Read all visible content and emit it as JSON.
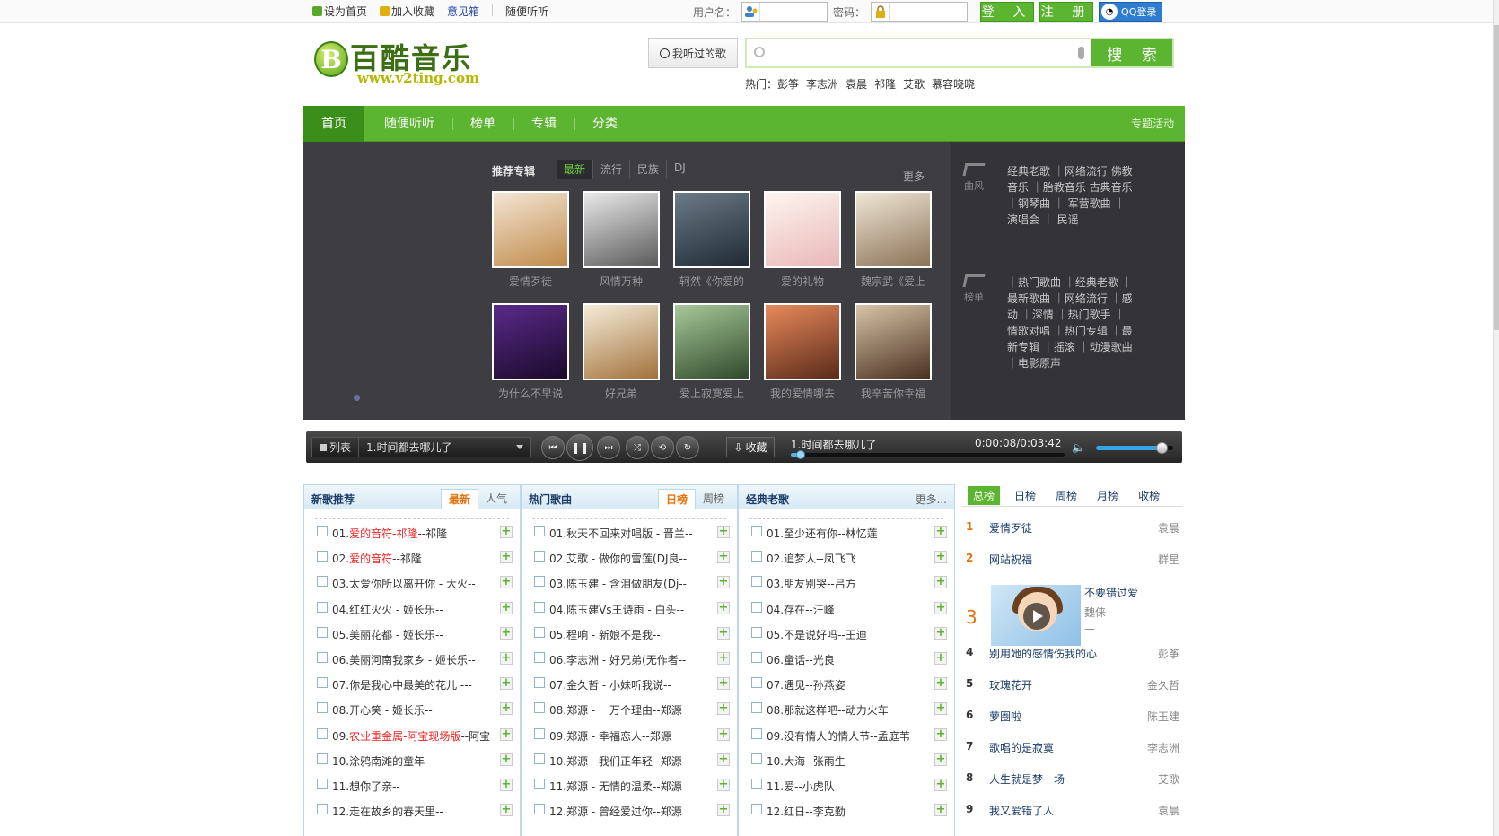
{
  "topbar": {
    "set_home": "设为首页",
    "add_fav": "加入收藏",
    "feedback": "意见箱",
    "random": "随便听听",
    "username_label": "用户名：",
    "password_label": "密码：",
    "login_btn": "登 入",
    "register_btn": "注 册",
    "qq_login": "QQ登录"
  },
  "header": {
    "logo_cn": "百酷音乐",
    "logo_url": "www.v2ting.com",
    "heard_btn": "我听过的歌",
    "search_btn": "搜 索",
    "hot_label": "热门：",
    "hot": [
      "彭筝",
      "李志洲",
      "袁晨",
      "祁隆",
      "艾歌",
      "慕容晓晓"
    ]
  },
  "nav": {
    "items": [
      "首页",
      "随便听听",
      "榜单",
      "专辑",
      "分类"
    ],
    "topic": "专题活动"
  },
  "banner": {
    "title": "推荐专辑",
    "tabs": [
      "最新",
      "流行",
      "民族",
      "DJ"
    ],
    "more": "更多",
    "albums": [
      {
        "name": "爱情歹徒",
        "color1": "#f3e5d4",
        "color2": "#c08a4a"
      },
      {
        "name": "风情万种",
        "color1": "#e9e9e9",
        "color2": "#5a5a5a"
      },
      {
        "name": "轲然《你爱的",
        "color1": "#6c7a88",
        "color2": "#1f2a33"
      },
      {
        "name": "爱的礼物",
        "color1": "#fdf5f0",
        "color2": "#e9b7b7"
      },
      {
        "name": "魏宗武《爱上",
        "color1": "#f0e6d6",
        "color2": "#8a7256"
      },
      {
        "name": "为什么不早说",
        "color1": "#5a2a8a",
        "color2": "#1a0a2a"
      },
      {
        "name": "好兄弟",
        "color1": "#f5ecd8",
        "color2": "#a2723c"
      },
      {
        "name": "爱上寂寞爱上",
        "color1": "#a8c89a",
        "color2": "#2f4a2a"
      },
      {
        "name": "我的爱情哪去",
        "color1": "#e88a5a",
        "color2": "#5a2a1a"
      },
      {
        "name": "我辛苦你幸福",
        "color1": "#d8c4a8",
        "color2": "#4a3020"
      }
    ],
    "cat1": {
      "icon_label": "曲风",
      "text": "经典老歌 ｜网络流行 佛教音乐 ｜胎教音乐 古典音乐 ｜钢琴曲 ｜ 军营歌曲 ｜演唱会 ｜ 民谣"
    },
    "cat2": {
      "icon_label": "榜单",
      "text": "｜热门歌曲 ｜经典老歌 ｜最新歌曲 ｜网络流行 ｜感动 ｜深情 ｜热门歌手 ｜情歌对唱 ｜热门专辑 ｜最新专辑 ｜摇滚 ｜动漫歌曲 ｜电影原声"
    }
  },
  "player": {
    "list_label": "列表",
    "current": "1.时间都去哪儿了",
    "collect": "收藏",
    "now_playing": "1.时间都去哪儿了",
    "time": "0:00:08/0:03:42",
    "progress": 0.036,
    "volume": 0.85
  },
  "lists": {
    "new": {
      "title": "新歌推荐",
      "tabs": [
        "最新",
        "人气"
      ],
      "rows": [
        {
          "pre": "01.",
          "red": "爱的音符-祁隆",
          "post": "--祁隆"
        },
        {
          "pre": "02.",
          "red": "爱的音符",
          "post": "--祁隆"
        },
        {
          "pre": "03.太爱你所以离开你 - 大火--",
          "red": "",
          "post": ""
        },
        {
          "pre": "04.红红火火 - 姬长乐--",
          "red": "",
          "post": ""
        },
        {
          "pre": "05.美丽花都 - 姬长乐--",
          "red": "",
          "post": ""
        },
        {
          "pre": "06.美丽河南我家乡 - 姬长乐--",
          "red": "",
          "post": ""
        },
        {
          "pre": "07.你是我心中最美的花儿 ---",
          "red": "",
          "post": ""
        },
        {
          "pre": "08.开心笑 - 姬长乐--",
          "red": "",
          "post": ""
        },
        {
          "pre": "09.",
          "red": "农业重金属-阿宝现场版",
          "post": "--阿宝"
        },
        {
          "pre": "10.涂鸦南滩的童年--",
          "red": "",
          "post": ""
        },
        {
          "pre": "11.想你了亲--",
          "red": "",
          "post": ""
        },
        {
          "pre": "12.走在故乡的春天里--",
          "red": "",
          "post": ""
        }
      ]
    },
    "hot": {
      "title": "热门歌曲",
      "tabs": [
        "日榜",
        "周榜"
      ],
      "rows": [
        "01.秋天不回来对唱版 - 晋兰--",
        "02.艾歌 - 做你的雪莲(DJ良--",
        "03.陈玉建 - 含泪做朋友(Dj--",
        "04.陈玉建Vs王诗雨 - 白头--",
        "05.程响 - 新娘不是我--",
        "06.李志洲 - 好兄弟(无作者--",
        "07.金久哲 - 小妹听我说--",
        "08.郑源 - 一万个理由--郑源",
        "09.郑源 - 幸福恋人--郑源",
        "10.郑源 - 我们正年轻--郑源",
        "11.郑源 - 无情的温柔--郑源",
        "12.郑源 - 曾经爱过你--郑源"
      ]
    },
    "classic": {
      "title": "经典老歌",
      "more": "更多...",
      "rows": [
        "01.至少还有你--林忆莲",
        "02.追梦人--凤飞飞",
        "03.朋友别哭--吕方",
        "04.存在--汪峰",
        "05.不是说好吗--王迪",
        "06.童话--光良",
        "07.遇见--孙燕姿",
        "08.那就这样吧--动力火车",
        "09.没有情人的情人节--孟庭苇",
        "10.大海--张雨生",
        "11.爱--小虎队",
        "12.红日--李克勤"
      ]
    }
  },
  "rank": {
    "tabs": [
      "总榜",
      "日榜",
      "周榜",
      "月榜",
      "收榜"
    ],
    "items": [
      {
        "n": "1",
        "song": "爱情歹徒",
        "artist": "袁晨"
      },
      {
        "n": "2",
        "song": "网站祝福",
        "artist": "群星"
      },
      {
        "n": "4",
        "song": "别用她的感情伤我的心",
        "artist": "彭筝"
      },
      {
        "n": "5",
        "song": "玫瑰花开",
        "artist": "金久哲"
      },
      {
        "n": "6",
        "song": "萝圈啦",
        "artist": "陈玉建"
      },
      {
        "n": "7",
        "song": "歌唱的是寂寞",
        "artist": "李志洲"
      },
      {
        "n": "8",
        "song": "人生就是梦一场",
        "artist": "艾歌"
      },
      {
        "n": "9",
        "song": "我又爱错了人",
        "artist": "袁晨"
      }
    ],
    "featured": {
      "n": "3",
      "song": "不要错过爱",
      "artist": "魏俫",
      "dash": "—"
    }
  }
}
